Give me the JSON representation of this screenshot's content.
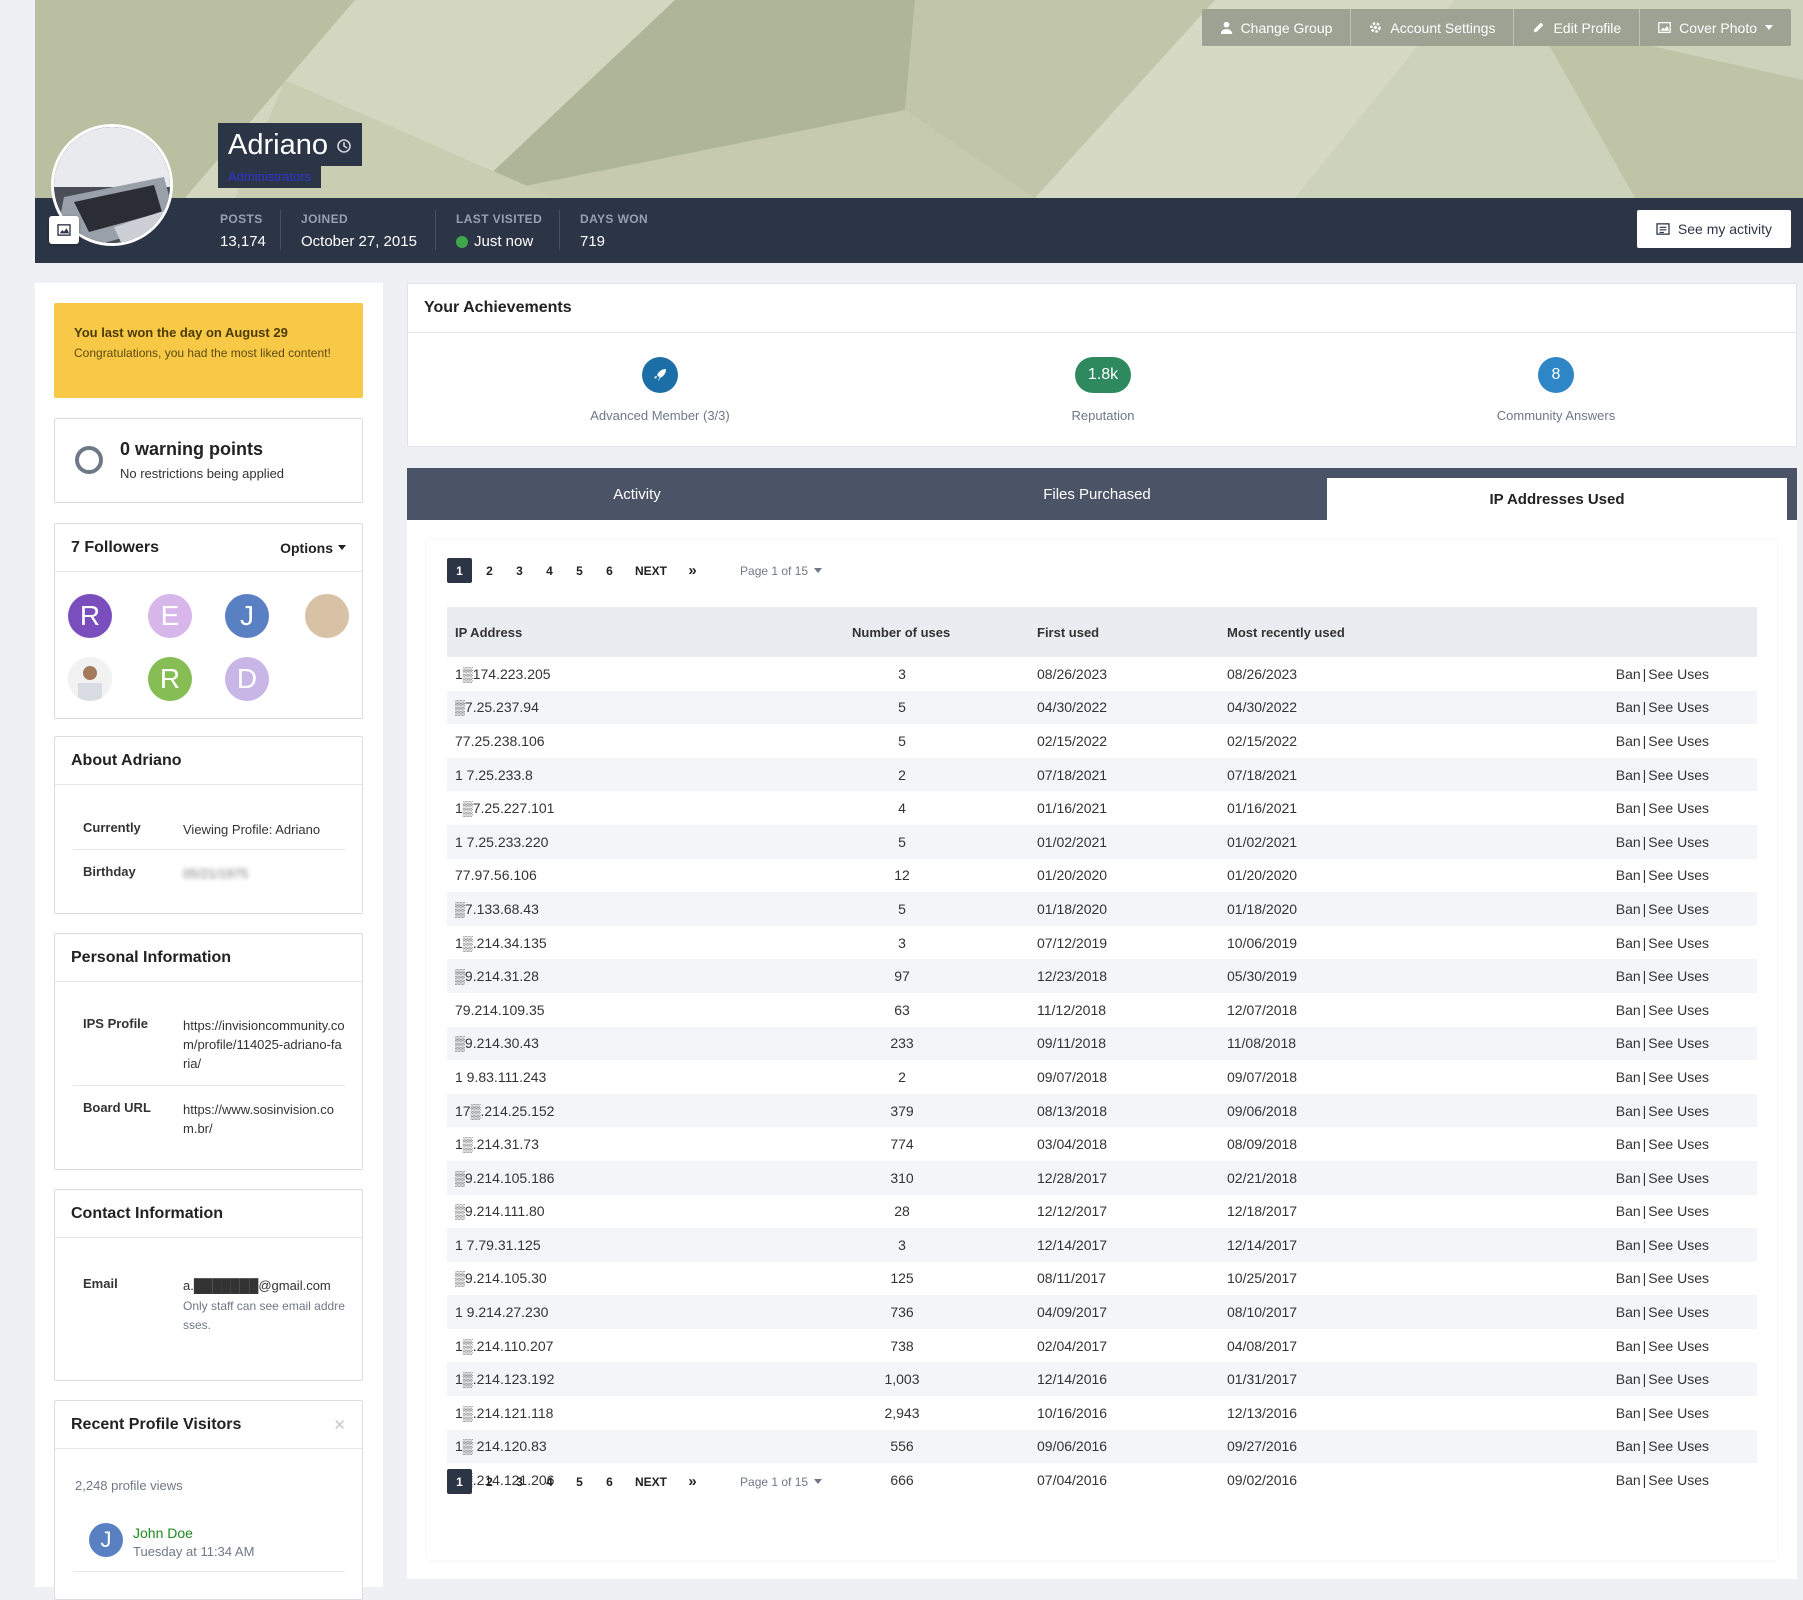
{
  "header": {
    "buttons": {
      "change_group": "Change Group",
      "account_settings": "Account Settings",
      "edit_profile": "Edit Profile",
      "cover_photo": "Cover Photo"
    },
    "name": "Adriano",
    "group": "Administrators",
    "stats": [
      {
        "label": "POSTS",
        "value": "13,174"
      },
      {
        "label": "JOINED",
        "value": "October 27, 2015"
      },
      {
        "label": "LAST VISITED",
        "value": "Just now"
      },
      {
        "label": "DAYS WON",
        "value": "719"
      }
    ],
    "see_activity": "See my activity",
    "colors": {
      "statbar": "#2c3546",
      "online": "#3fa64e",
      "group_text": "#2f34d2"
    }
  },
  "sidebar": {
    "day_won": {
      "title": "You last won the day on August 29",
      "text": "Congratulations, you had the most liked content!"
    },
    "warnings": {
      "title": "0 warning points",
      "subtitle": "No restrictions being applied"
    },
    "followers": {
      "title": "7 Followers",
      "options": "Options",
      "list": [
        {
          "initial": "R",
          "color": "#7a4fbd"
        },
        {
          "initial": "E",
          "color": "#d7b7ea"
        },
        {
          "initial": "J",
          "color": "#5a80c4"
        },
        {
          "initial": "",
          "color": "#d8c2a6"
        },
        {
          "initial": "",
          "color": "#e9e9e9"
        },
        {
          "initial": "R",
          "color": "#86bd55"
        },
        {
          "initial": "D",
          "color": "#c8b6e6"
        }
      ]
    },
    "about": {
      "title": "About Adriano",
      "rows": [
        {
          "key": "Currently",
          "value": "Viewing Profile: Adriano"
        },
        {
          "key": "Birthday",
          "value": "05/21/1975"
        }
      ]
    },
    "personal": {
      "title": "Personal Information",
      "rows": [
        {
          "key": "IPS Profile",
          "value": "https://invisioncommunity.com/profile/114025-adriano-faria/"
        },
        {
          "key": "Board URL",
          "value": "https://www.sosinvision.com.br/"
        }
      ]
    },
    "contact": {
      "title": "Contact Information",
      "email_key": "Email",
      "email_value": "a.███████@gmail.com",
      "email_note": "Only staff can see email addresses."
    },
    "visitors": {
      "title": "Recent Profile Visitors",
      "views": "2,248 profile views",
      "list": [
        {
          "initial": "J",
          "name": "John Doe",
          "time": "Tuesday at 11:34 AM"
        }
      ]
    }
  },
  "achievements": {
    "title": "Your Achievements",
    "items": [
      {
        "badge": "rocket-icon",
        "label": "Advanced Member (3/3)",
        "color": "#1c6fa6"
      },
      {
        "badge": "1.8k",
        "label": "Reputation",
        "color": "#2e8a5e"
      },
      {
        "badge": "8",
        "label": "Community Answers",
        "color": "#2f86c7"
      }
    ]
  },
  "tabs": [
    {
      "label": "Activity",
      "active": false
    },
    {
      "label": "Files Purchased",
      "active": false
    },
    {
      "label": "IP Addresses Used",
      "active": true
    }
  ],
  "pagination": {
    "pages": [
      "1",
      "2",
      "3",
      "4",
      "5",
      "6"
    ],
    "current": "1",
    "next": "NEXT",
    "last": "»",
    "info": "Page 1 of 15"
  },
  "ip_table": {
    "columns": [
      "IP Address",
      "Number of uses",
      "First used",
      "Most recently used",
      ""
    ],
    "action_ban": "Ban",
    "action_separator": "|",
    "action_see": "See Uses",
    "rows": [
      [
        "1▒174.223.205",
        "3",
        "08/26/2023",
        "08/26/2023"
      ],
      [
        "▒7.25.237.94",
        "5",
        "04/30/2022",
        "04/30/2022"
      ],
      [
        "77.25.238.106",
        "5",
        "02/15/2022",
        "02/15/2022"
      ],
      [
        "1 7.25.233.8",
        "2",
        "07/18/2021",
        "07/18/2021"
      ],
      [
        "1▒7.25.227.101",
        "4",
        "01/16/2021",
        "01/16/2021"
      ],
      [
        "1 7.25.233.220",
        "5",
        "01/02/2021",
        "01/02/2021"
      ],
      [
        "77.97.56.106",
        "12",
        "01/20/2020",
        "01/20/2020"
      ],
      [
        "▒7.133.68.43",
        "5",
        "01/18/2020",
        "01/18/2020"
      ],
      [
        "1▒.214.34.135",
        "3",
        "07/12/2019",
        "10/06/2019"
      ],
      [
        "▒9.214.31.28",
        "97",
        "12/23/2018",
        "05/30/2019"
      ],
      [
        "79.214.109.35",
        "63",
        "11/12/2018",
        "12/07/2018"
      ],
      [
        "▒9.214.30.43",
        "233",
        "09/11/2018",
        "11/08/2018"
      ],
      [
        "1 9.83.111.243",
        "2",
        "09/07/2018",
        "09/07/2018"
      ],
      [
        "17▒.214.25.152",
        "379",
        "08/13/2018",
        "09/06/2018"
      ],
      [
        "1▒.214.31.73",
        "774",
        "03/04/2018",
        "08/09/2018"
      ],
      [
        "▒9.214.105.186",
        "310",
        "12/28/2017",
        "02/21/2018"
      ],
      [
        "▒9.214.111.80",
        "28",
        "12/12/2017",
        "12/18/2017"
      ],
      [
        "1 7.79.31.125",
        "3",
        "12/14/2017",
        "12/14/2017"
      ],
      [
        "▒9.214.105.30",
        "125",
        "08/11/2017",
        "10/25/2017"
      ],
      [
        "1 9.214.27.230",
        "736",
        "04/09/2017",
        "08/10/2017"
      ],
      [
        "1▒.214.110.207",
        "738",
        "02/04/2017",
        "04/08/2017"
      ],
      [
        "1▒.214.123.192",
        "1,003",
        "12/14/2016",
        "01/31/2017"
      ],
      [
        "1▒.214.121.118",
        "2,943",
        "10/16/2016",
        "12/13/2016"
      ],
      [
        "1▒ 214.120.83",
        "556",
        "09/06/2016",
        "09/27/2016"
      ],
      [
        "1▒.214.121.206",
        "666",
        "07/04/2016",
        "09/02/2016"
      ]
    ]
  }
}
